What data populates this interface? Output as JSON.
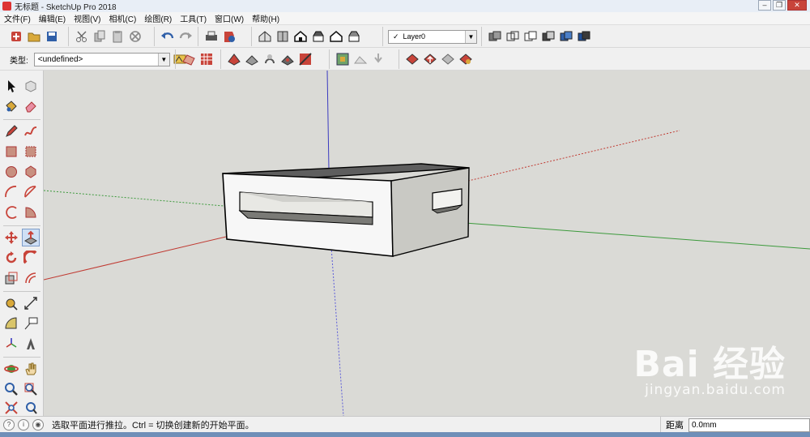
{
  "window": {
    "title": "无标题 - SketchUp Pro 2018",
    "minimize": "‒",
    "maximize": "❐",
    "close": "✕"
  },
  "menu": [
    "文件(F)",
    "编辑(E)",
    "视图(V)",
    "相机(C)",
    "绘图(R)",
    "工具(T)",
    "窗口(W)",
    "帮助(H)"
  ],
  "toolbar": {
    "layer": {
      "check": "✓",
      "value": "Layer0",
      "arrow": "▼"
    },
    "type": {
      "label": "类型:",
      "value": "<undefined>",
      "arrow": "▼"
    }
  },
  "colors": {
    "viewport_bg": "#dadad6",
    "axis_red": "#c03a32",
    "axis_green": "#3c9a3c",
    "axis_blue": "#3a3ac0",
    "accent_red": "#c8443a",
    "accent_blue": "#2f5fa8"
  },
  "watermark": {
    "logo": "Bai 经验",
    "site": "jingyan.baidu.com"
  },
  "status": {
    "icons": [
      "?",
      "i",
      "◉"
    ],
    "message": "选取平面进行推拉。Ctrl = 切换创建新的开始平面。",
    "measure_label": "距离",
    "measure_value": "0.0mm"
  }
}
